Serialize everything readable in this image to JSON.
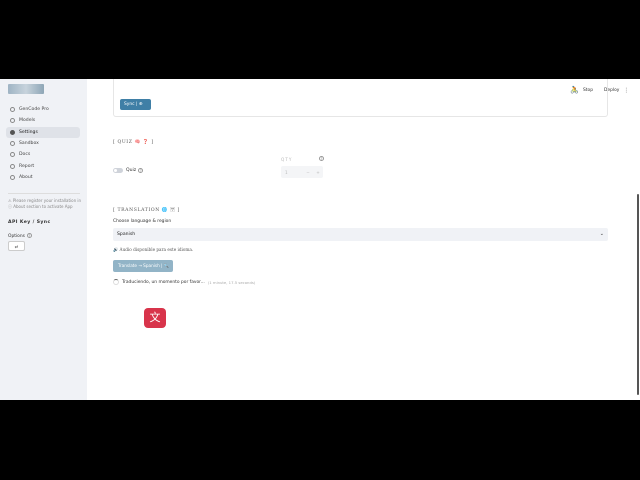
{
  "sidebar": {
    "items": [
      {
        "label": "GenCode Pro",
        "active": false
      },
      {
        "label": "Models",
        "active": false
      },
      {
        "label": "Settings",
        "active": true
      },
      {
        "label": "Sandbox",
        "active": false
      },
      {
        "label": "Docs",
        "active": false
      },
      {
        "label": "Report",
        "active": false
      },
      {
        "label": "About",
        "active": false
      }
    ],
    "note": "⚠ Please register your installation in ⓘ About section to activate App",
    "api_label": "API Key / Sync",
    "options_label": "Options",
    "options_button": "⇄"
  },
  "topbar": {
    "stop": "Stop",
    "deploy": "Deploy"
  },
  "sync_button": "Sync | ⊕",
  "quiz": {
    "title": "[ QUIZ 🧠 ❓ ]",
    "toggle_label": "Quiz",
    "qty_label": "QTY",
    "qty_value": "1",
    "minus": "−",
    "plus": "+"
  },
  "translation": {
    "title": "[ TRANSLATION 🌐 🈂 ]",
    "lang_label": "Choose language & region",
    "selected_language": "Spanish",
    "audio_note": "🔊  Audio disponible para este idioma.",
    "translate_button": "Translate → Spanish | 🔍",
    "status_text": "Traduciendo, un momento por favor...",
    "elapsed": "(1 minute, 17.5 seconds)",
    "icon_glyph": "文"
  },
  "colors": {
    "accent": "#3f7fa6",
    "translate_button": "#92b4c7",
    "translate_icon": "#d8344b",
    "sidebar_bg": "#f0f2f6"
  }
}
